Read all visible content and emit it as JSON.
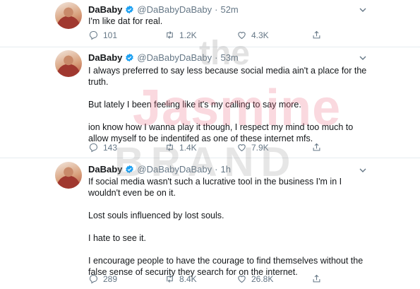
{
  "watermark": {
    "line1": "the",
    "line2": "Jasmine",
    "line3": "BRAND"
  },
  "tweets": [
    {
      "name": "DaBaby",
      "handle": "@DaBabyDaBaby",
      "dot": "·",
      "time": "52m",
      "paragraphs": [
        "I'm like dat for real."
      ],
      "replies": "101",
      "retweets": "1.2K",
      "likes": "4.3K"
    },
    {
      "name": "DaBaby",
      "handle": "@DaBabyDaBaby",
      "dot": "·",
      "time": "53m",
      "paragraphs": [
        "I always preferred to say less because social media ain't a place for the truth.",
        "But lately I been feeling like it's my calling to say more.",
        "ion know how I wanna play it though, I respect my mind too much to allow myself to be indentifed as one of these internet mfs."
      ],
      "replies": "143",
      "retweets": "1.4K",
      "likes": "7.9K"
    },
    {
      "name": "DaBaby",
      "handle": "@DaBabyDaBaby",
      "dot": "·",
      "time": "1h",
      "paragraphs": [
        "If social media wasn't such a lucrative tool in the business I'm in I wouldn't even be on it.",
        "Lost souls influenced by lost souls.",
        "I hate to see it.",
        "I encourage people to have the courage to find themselves without the false sense of security they search for on the internet."
      ],
      "replies": "289",
      "retweets": "8.4K",
      "likes": "26.8K"
    }
  ],
  "colors": {
    "verified": "#1da1f2",
    "muted": "#657786",
    "text": "#14171a",
    "divider": "#e6ecf0"
  },
  "icons": [
    "verified-badge-icon",
    "chevron-down-icon",
    "reply-icon",
    "retweet-icon",
    "like-icon",
    "share-icon"
  ]
}
